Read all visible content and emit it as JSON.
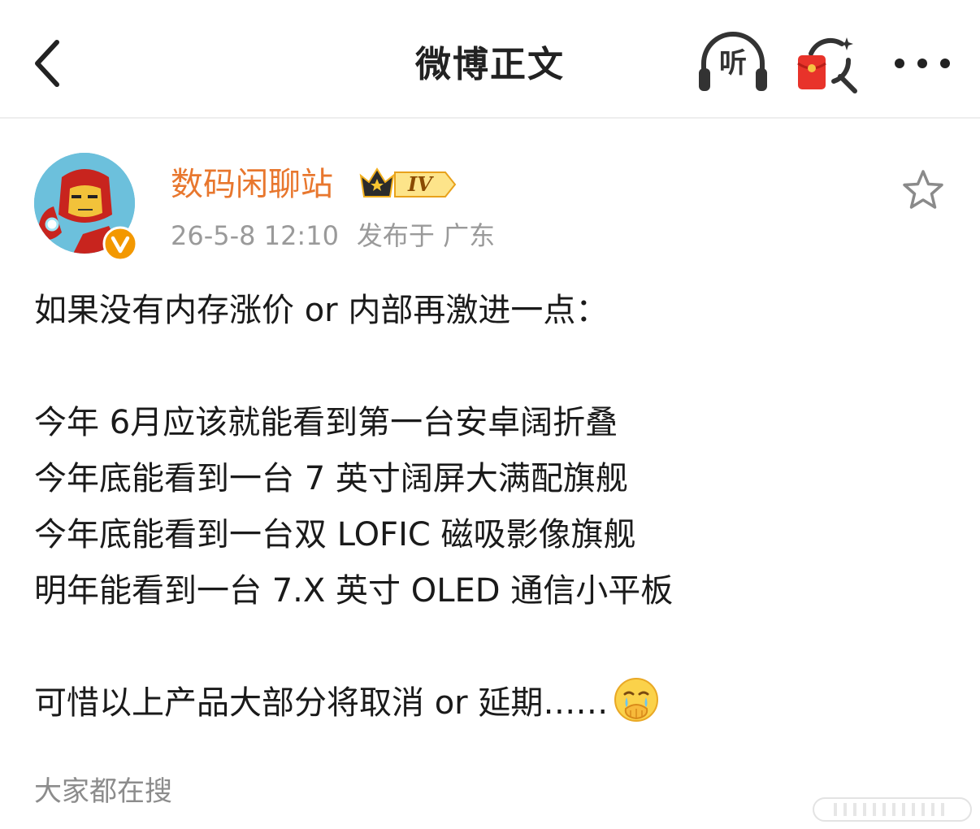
{
  "navbar": {
    "title": "微博正文",
    "listen_label": "听",
    "icons": {
      "back": "chevron-left-icon",
      "listen": "headphones-icon",
      "red_packet": "red-packet-search-icon",
      "more": "more-dots-icon"
    }
  },
  "post": {
    "author": {
      "name": "数码闲聊站",
      "rank_label": "IV",
      "avatar_icon": "ironman-avatar",
      "verified_icon": "verified-v-icon",
      "crown_icon": "crown-icon"
    },
    "time": "26-5-8 12:10",
    "location": "发布于 广东",
    "favorite_icon": "star-outline-icon",
    "lines": [
      "如果没有内存涨价 or 内部再激进一点：",
      "",
      "今年 6月应该就能看到第一台安卓阔折叠",
      "今年底能看到一台 7 英寸阔屏大满配旗舰",
      "今年底能看到一台双 LOFIC 磁吸影像旗舰",
      "明年能看到一台 7.X 英寸 OLED 通信小平板",
      "",
      "可惜以上产品大部分将取消 or 延期……"
    ],
    "emoji_icon": "crying-covering-mouth-emoji"
  },
  "footer": {
    "trending_label": "大家都在搜"
  },
  "colors": {
    "username": "#e8772e",
    "meta": "#9a9a9a",
    "text": "#1a1a1a",
    "verified": "#f39800",
    "red_packet": "#e8332a"
  }
}
